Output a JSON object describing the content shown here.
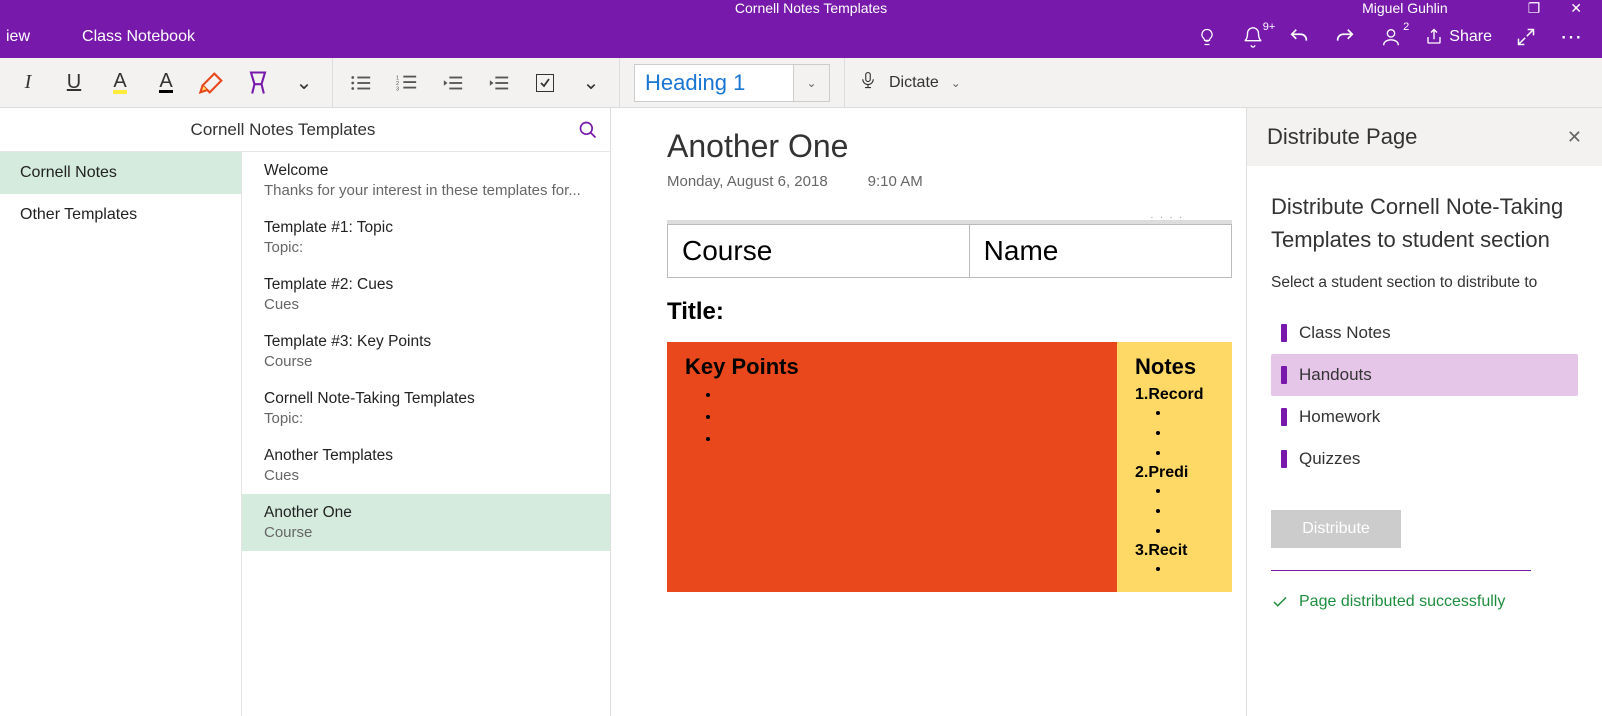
{
  "titlebar": {
    "title": "Cornell Notes Templates",
    "user": "Miguel Guhlin"
  },
  "tabs": {
    "view": "iew",
    "classnb": "Class Notebook",
    "share": "Share",
    "notif_badge": "9+",
    "acct_badge": "2"
  },
  "ribbon": {
    "style": "Heading 1",
    "dictate": "Dictate"
  },
  "nav": {
    "title": "Cornell Notes Templates",
    "sections": [
      {
        "name": "Cornell Notes",
        "active": true
      },
      {
        "name": "Other Templates",
        "active": false
      }
    ],
    "pages": [
      {
        "title": "Welcome",
        "sub": "Thanks for your interest in these templates for..."
      },
      {
        "title": "Template #1: Topic",
        "sub": "Topic:"
      },
      {
        "title": "Template #2: Cues",
        "sub": "Cues"
      },
      {
        "title": "Template #3: Key Points",
        "sub": "Course"
      },
      {
        "title": "Cornell Note-Taking Templates",
        "sub": "Topic:"
      },
      {
        "title": "Another Templates",
        "sub": "Cues"
      },
      {
        "title": "Another One",
        "sub": "Course",
        "active": true
      }
    ]
  },
  "canvas": {
    "heading": "Another One",
    "date": "Monday, August 6, 2018",
    "time": "9:10 AM",
    "table": {
      "c1": "Course",
      "c2": "Name"
    },
    "title_label": "Title:",
    "keypoints_hdr": "Key Points",
    "notes_hdr": "Notes",
    "steps": [
      "1.Record",
      "2.Predi",
      "3.Recit"
    ]
  },
  "panel": {
    "header": "Distribute Page",
    "title": "Distribute Cornell Note-Taking Templates to student section",
    "instr": "Select a student section to distribute to",
    "sections": [
      {
        "name": "Class Notes"
      },
      {
        "name": "Handouts",
        "selected": true
      },
      {
        "name": "Homework"
      },
      {
        "name": "Quizzes"
      }
    ],
    "button": "Distribute",
    "success": "Page distributed successfully"
  }
}
